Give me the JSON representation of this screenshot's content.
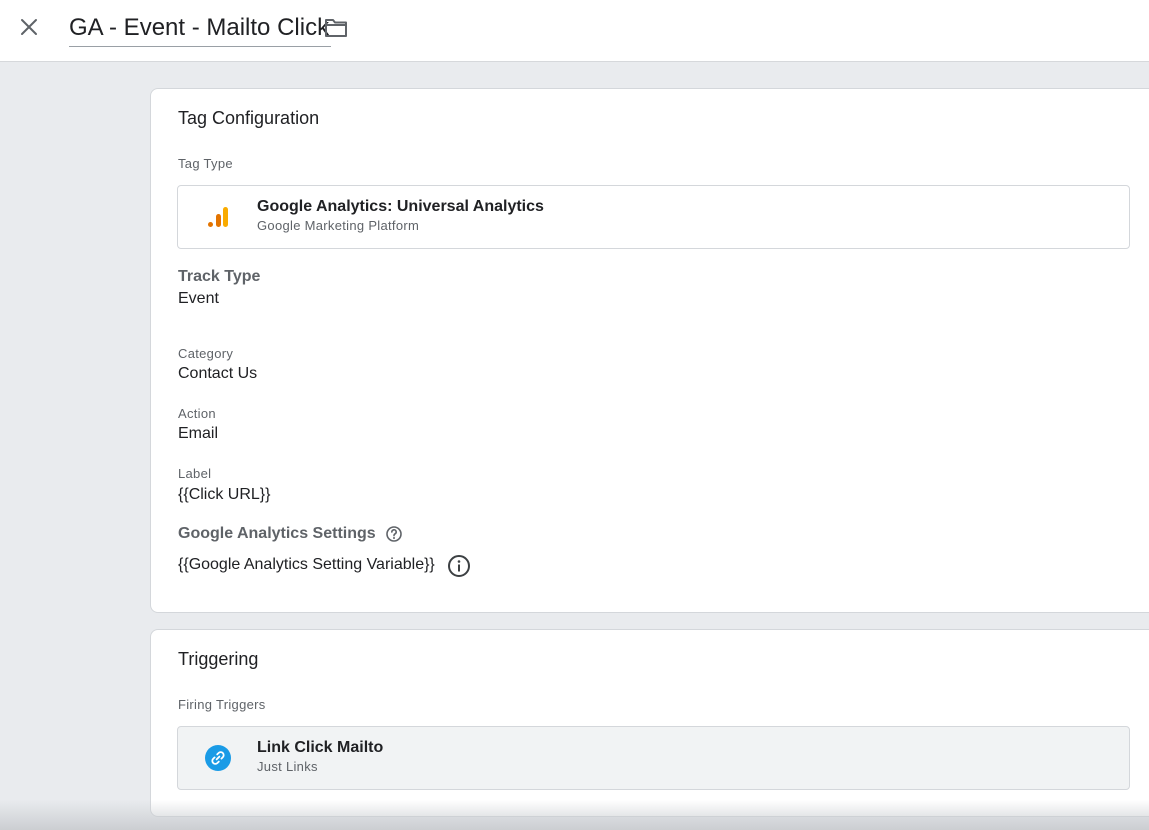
{
  "header": {
    "title": "GA - Event - Mailto Click",
    "close_icon": "close-icon",
    "folder_icon": "folder-icon"
  },
  "tag_configuration": {
    "title": "Tag Configuration",
    "tag_type_label": "Tag Type",
    "tag_type": {
      "name": "Google Analytics: Universal Analytics",
      "vendor": "Google Marketing Platform",
      "icon": "google-analytics-icon"
    },
    "track_type_label": "Track Type",
    "track_type_value": "Event",
    "category_label": "Category",
    "category_value": "Contact Us",
    "action_label": "Action",
    "action_value": "Email",
    "label_label": "Label",
    "label_value": "{{Click URL}}",
    "ga_settings_label": "Google Analytics Settings",
    "ga_settings_value": "{{Google Analytics Setting Variable}}"
  },
  "triggering": {
    "title": "Triggering",
    "firing_triggers_label": "Firing Triggers",
    "trigger": {
      "name": "Link Click Mailto",
      "type": "Just Links",
      "icon": "link-icon",
      "icon_color": "#1a9be6"
    }
  },
  "colors": {
    "ga_orange": "#f9ab00",
    "ga_dark_orange": "#e37400",
    "link_blue": "#1a9be6"
  }
}
